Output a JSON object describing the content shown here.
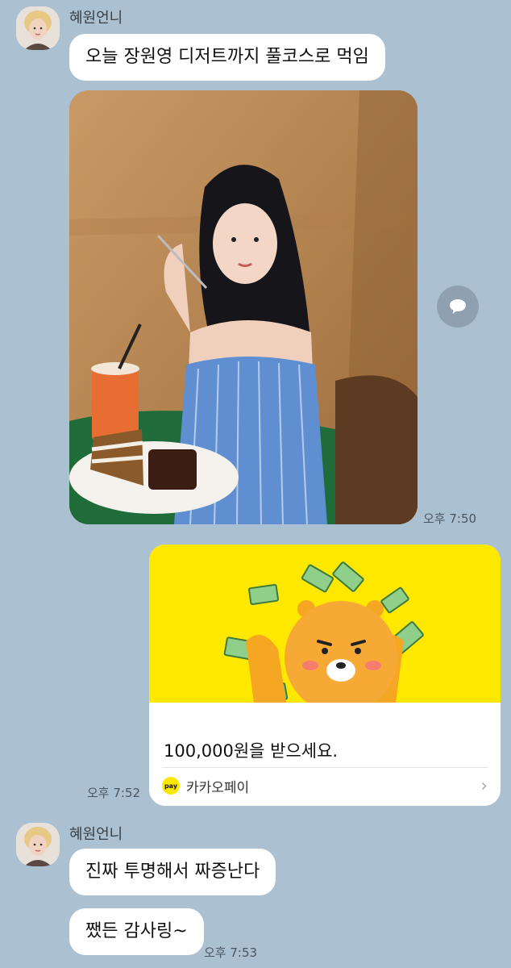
{
  "messages": [
    {
      "sender": "혜원언니",
      "text": "오늘 장원영 디저트까지 풀코스로 먹임"
    },
    {
      "photo_time": "오후 7:50"
    },
    {
      "payment": {
        "amount_text": "100,000원을 받으세요.",
        "brand": "카카오페이",
        "pay_badge": "pay",
        "time": "오후 7:52"
      }
    },
    {
      "sender": "혜원언니",
      "text": "진짜 투명해서 짜증난다"
    },
    {
      "text": "쨌든 감사링~",
      "time": "오후 7:53"
    }
  ],
  "colors": {
    "chat_bg": "#abc1d1",
    "bubble_bg": "#ffffff",
    "kakaopay_yellow": "#ffe800"
  },
  "icons": {
    "share": "speech-bubble-share-icon",
    "chevron": "chevron-right-icon"
  }
}
